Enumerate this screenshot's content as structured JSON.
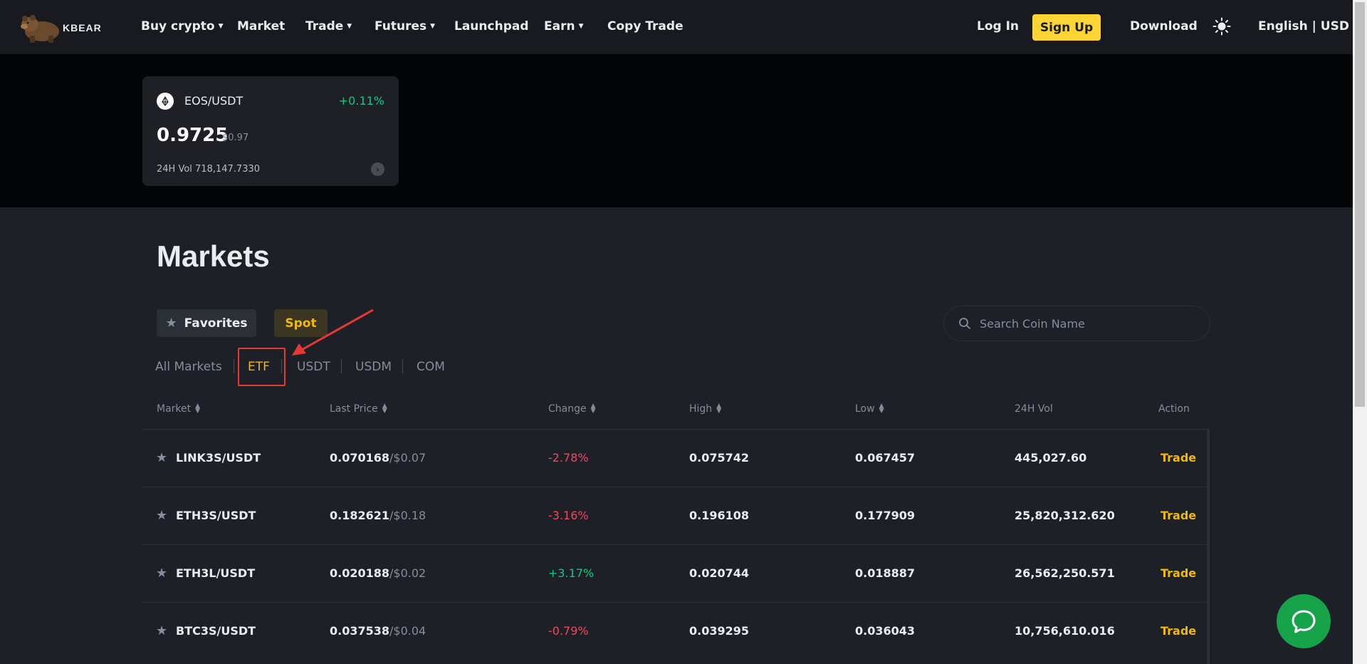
{
  "brand": {
    "name": "KBEAR"
  },
  "nav": {
    "buy_crypto": "Buy crypto",
    "market": "Market",
    "trade": "Trade",
    "futures": "Futures",
    "launchpad": "Launchpad",
    "earn": "Earn",
    "copy_trade": "Copy Trade",
    "login": "Log In",
    "signup": "Sign Up",
    "download": "Download",
    "language": "English | USD"
  },
  "ticker": {
    "pair": "EOS/USDT",
    "change": "+0.11%",
    "price": "0.9725",
    "price_usd": "$0.97",
    "volume": "24H Vol 718,147.7330"
  },
  "markets": {
    "title": "Markets",
    "favorites_label": "Favorites",
    "spot_label": "Spot",
    "search_placeholder": "Search Coin Name",
    "subtabs": [
      "All Markets",
      "ETF",
      "USDT",
      "USDM",
      "COM"
    ],
    "active_subtab": "ETF",
    "columns": [
      "Market",
      "Last Price",
      "Change",
      "High",
      "Low",
      "24H Vol",
      "Action"
    ],
    "rows": [
      {
        "market": "LINK3S/USDT",
        "last": "0.070168",
        "last_usd": "/$0.07",
        "change": "-2.78%",
        "high": "0.075742",
        "low": "0.067457",
        "vol": "445,027.60",
        "action": "Trade"
      },
      {
        "market": "ETH3S/USDT",
        "last": "0.182621",
        "last_usd": "/$0.18",
        "change": "-3.16%",
        "high": "0.196108",
        "low": "0.177909",
        "vol": "25,820,312.620",
        "action": "Trade"
      },
      {
        "market": "ETH3L/USDT",
        "last": "0.020188",
        "last_usd": "/$0.02",
        "change": "+3.17%",
        "high": "0.020744",
        "low": "0.018887",
        "vol": "26,562,250.571",
        "action": "Trade"
      },
      {
        "market": "BTC3S/USDT",
        "last": "0.037538",
        "last_usd": "/$0.04",
        "change": "-0.79%",
        "high": "0.039295",
        "low": "0.036043",
        "vol": "10,756,610.016",
        "action": "Trade"
      }
    ]
  },
  "colors": {
    "accent": "#fcd535",
    "up": "#0ecb81",
    "down": "#f6465d",
    "annotation": "#e53935"
  }
}
